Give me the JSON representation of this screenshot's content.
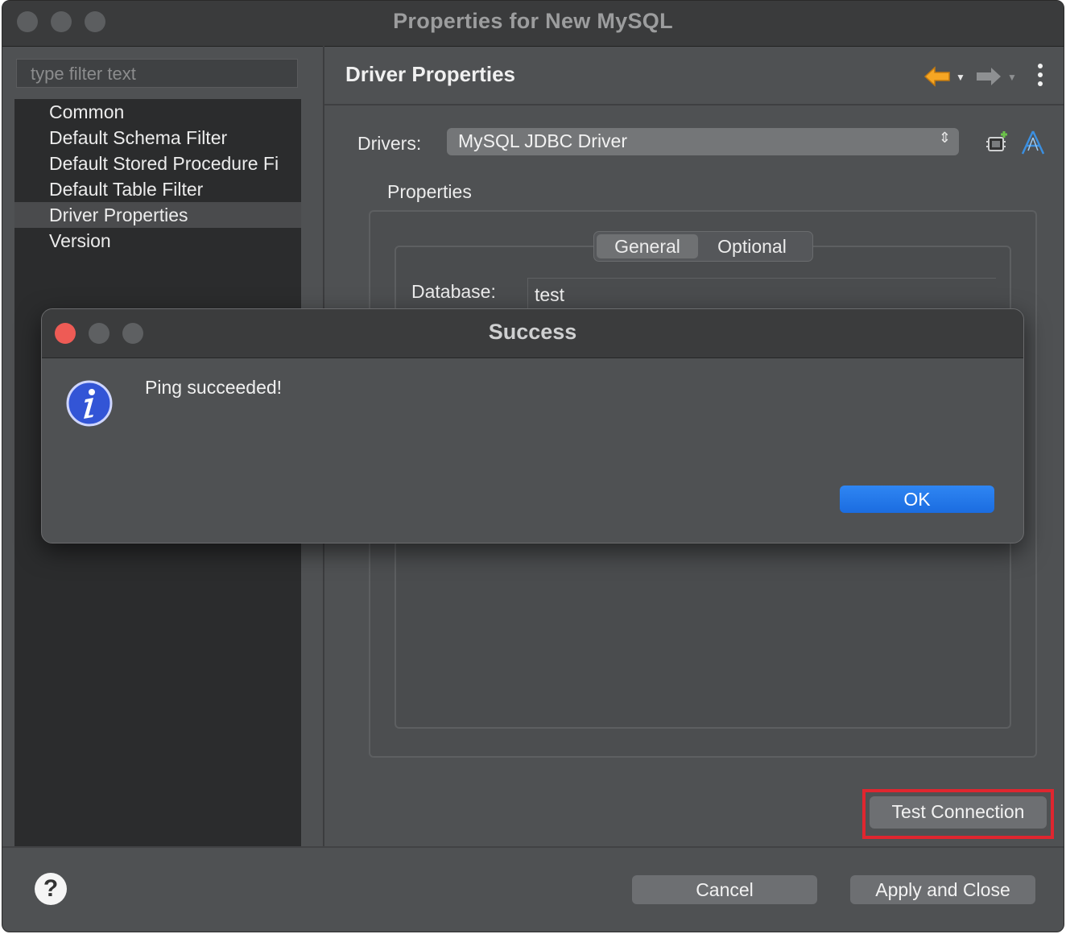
{
  "window": {
    "title": "Properties for New MySQL"
  },
  "sidebar": {
    "filter_placeholder": "type filter text",
    "items": [
      {
        "label": "Common"
      },
      {
        "label": "Default Schema Filter"
      },
      {
        "label": "Default Stored Procedure Fi"
      },
      {
        "label": "Default Table Filter"
      },
      {
        "label": "Driver Properties"
      },
      {
        "label": "Version"
      }
    ],
    "selected": "Driver Properties"
  },
  "main": {
    "title": "Driver Properties",
    "drivers_label": "Drivers:",
    "driver_selected": "MySQL JDBC Driver",
    "properties_label": "Properties",
    "tabs": [
      {
        "label": "General"
      },
      {
        "label": "Optional"
      }
    ],
    "active_tab": "General",
    "database_label": "Database:",
    "database_value": "test",
    "test_connection_label": "Test Connection"
  },
  "footer": {
    "help_glyph": "?",
    "cancel_label": "Cancel",
    "apply_label": "Apply and Close"
  },
  "dialog": {
    "title": "Success",
    "message": "Ping succeeded!",
    "ok_label": "OK",
    "icon": "info-icon"
  },
  "colors": {
    "highlight": "#e0262f",
    "ok_button": "#1f74e8",
    "close_red": "#ee5b55",
    "back_arrow": "#f6a623"
  }
}
